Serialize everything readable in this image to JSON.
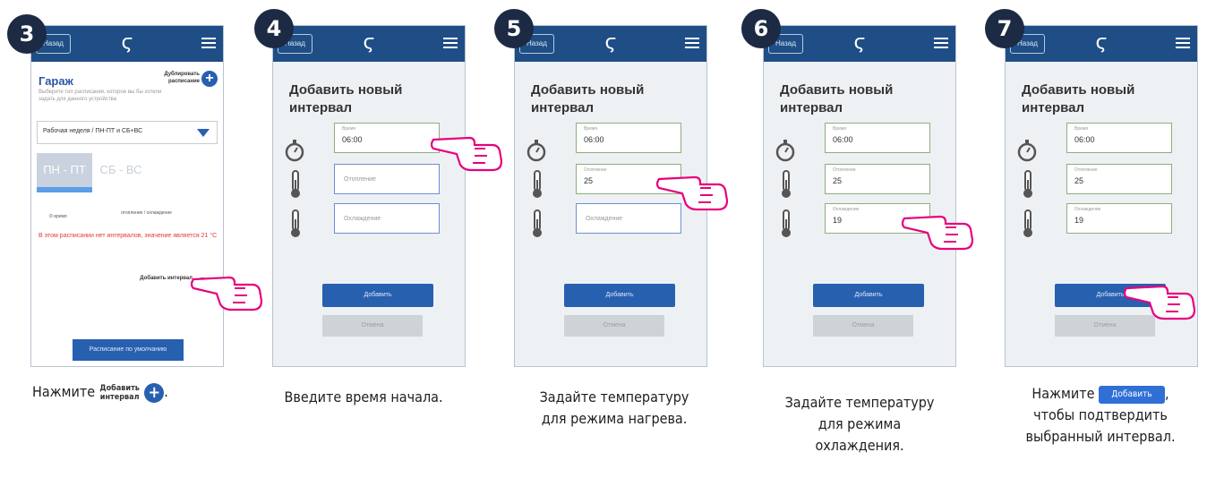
{
  "common": {
    "back_label": "Назад",
    "logo_glyph": "ϛ",
    "form_title": "Добавить новый интервал",
    "time_label": "Время",
    "heating_label": "Отопление",
    "cooling_label": "Охлаждение",
    "add_button": "Добавить",
    "cancel_button": "Отмена",
    "hand_color": "#e6007e",
    "accent": "#1f4e86"
  },
  "steps": [
    {
      "number": "3"
    },
    {
      "number": "4"
    },
    {
      "number": "5"
    },
    {
      "number": "6"
    },
    {
      "number": "7"
    }
  ],
  "step3": {
    "title": "Гараж",
    "subtitle": "Выберите тип расписания, которое вы бы хотели задать для данного устройства",
    "duplicate": "Дублировать расписание",
    "schedule_select": "Рабочая неделя / ПН-ПТ и СБ+ВС",
    "tab_weekdays": "ПН - ПТ",
    "tab_weekend": "СБ - ВС",
    "legend_time": "время",
    "legend_heat_cool": "отопление / охлаждение",
    "warning": "В этом расписании нет интервалов, значение является 21 °C",
    "add_interval": "Добавить интервал",
    "default_schedule": "Расписание по умолчанию"
  },
  "values": {
    "time": "06:00",
    "heating": "25",
    "cooling": "19"
  },
  "captions": {
    "c3_prefix": "Нажмите",
    "c3_inline": "Добавить интервал",
    "c3_suffix": ".",
    "c4": "Введите время начала.",
    "c5_line1": "Задайте температуру",
    "c5_line2": "для режима нагрева.",
    "c6_line1": "Задайте температуру",
    "c6_line2": "для режима",
    "c6_line3": "охлаждения.",
    "c7_prefix": "Нажмите",
    "c7_inline": "Добавить",
    "c7_suffix": ",",
    "c7_line2": "чтобы подтвердить",
    "c7_line3": "выбранный интервал."
  }
}
